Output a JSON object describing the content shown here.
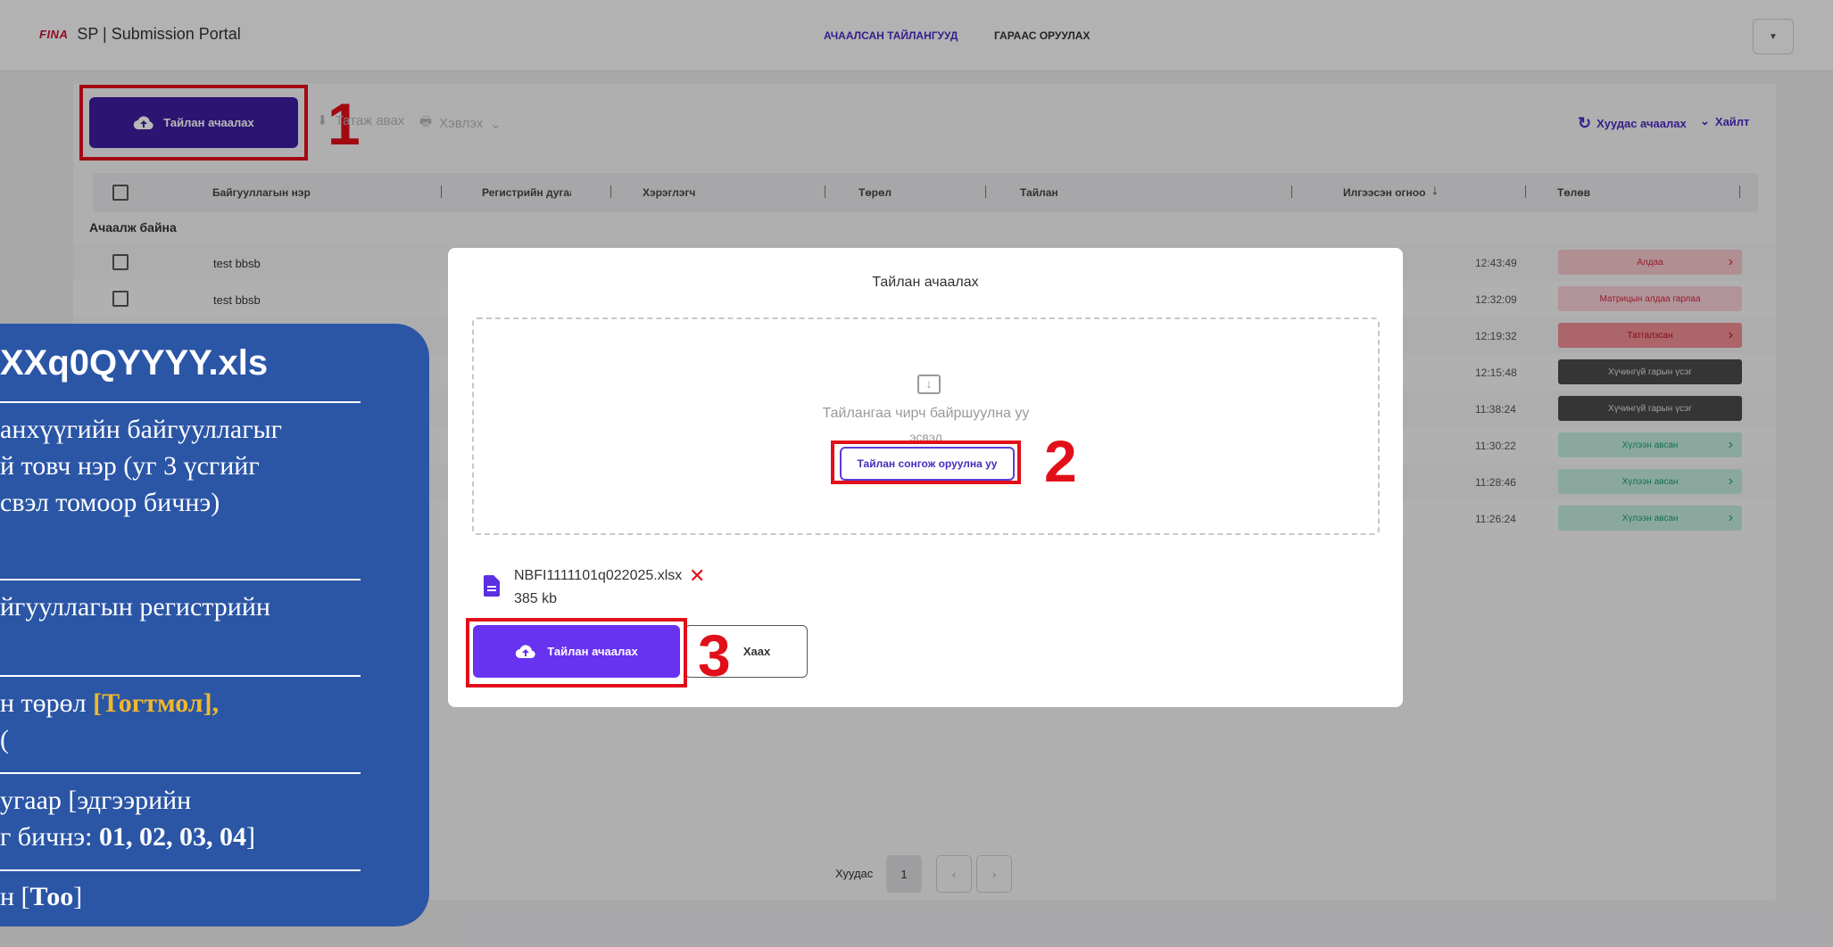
{
  "header": {
    "logo": "FINA",
    "title": "SP | Submission Portal",
    "nav": [
      "АЧААЛСАН ТАЙЛАНГУУД",
      "ГАРААС ОРУУЛАХ"
    ]
  },
  "toolbar": {
    "upload_label": "Тайлан ачаалах",
    "download_label": "Татаж авах",
    "print_label": "Хэвлэх",
    "reload_label": "Хуудас ачаалах",
    "search_label": "Хайлт"
  },
  "markers": [
    "1",
    "2",
    "3"
  ],
  "table": {
    "columns": [
      "Байгууллагын нэр",
      "Регистрийн дугаар",
      "Хэрэглэгч",
      "Төрөл",
      "Тайлан",
      "Илгээсэн огноо",
      "Төлөв"
    ],
    "group_title": "Ачаалж байна",
    "rows": [
      {
        "name": "test bbsb",
        "time": "12:43:49",
        "status": "Алдаа"
      },
      {
        "name": "test bbsb",
        "time": "12:32:09",
        "status": "Матрицын алдаа гарлаа"
      },
      {
        "name": "",
        "time": "12:19:32",
        "status": "Татгалзсан"
      },
      {
        "name": "",
        "time": "12:15:48",
        "status": "Хүчингүй гарын үсэг"
      },
      {
        "name": "",
        "time": "11:38:24",
        "status": "Хүчингүй гарын үсэг"
      },
      {
        "name": "",
        "time": "11:30:22",
        "status": "Хүлээн авсан"
      },
      {
        "name": "",
        "time": "11:28:46",
        "status": "Хүлээн авсан"
      },
      {
        "name": "",
        "time": "11:26:24",
        "status": "Хүлээн авсан"
      }
    ]
  },
  "pagination": {
    "label": "Хуудас",
    "current": "1"
  },
  "modal": {
    "title": "Тайлан ачаалах",
    "drop_text": "Тайлангаа чирч байршуулна уу",
    "or_text": "эсвэл",
    "select_label": "Тайлан сонгож оруулна уу",
    "file_name": "NBFI1111101q022025.xlsx",
    "file_size": "385 kb",
    "upload_label": "Тайлан ачаалах",
    "close_label": "Хаах"
  },
  "info_card": {
    "title": "XXq0QYYYY.xls",
    "p1_l1": "анхүүгийн байгууллагыг",
    "p1_l2": "й товч нэр (уг 3 үсгийг",
    "p1_l3": "свэл томоор бичнэ)",
    "p2_l1": "йгууллагын регистрийн",
    "p3_pre": "н төрөл ",
    "p3_highlight": "[Тогтмол]",
    "p3_post": ",",
    "p3_l2": "(",
    "p4_l1": "угаар [эдгээрийн",
    "p4_pre": "г бичнэ: ",
    "p4_bold": "01, 02, 03, 04",
    "p4_post": "]",
    "p5_pre": "н [",
    "p5_bold": "Тоо",
    "p5_post": "]"
  },
  "colors": {
    "primary": "#3d1e9e",
    "modal_button": "#6732f0",
    "marker_red": "#e10f1a",
    "info_blue": "#2b56a6",
    "highlight_yellow": "#f0b82d"
  }
}
